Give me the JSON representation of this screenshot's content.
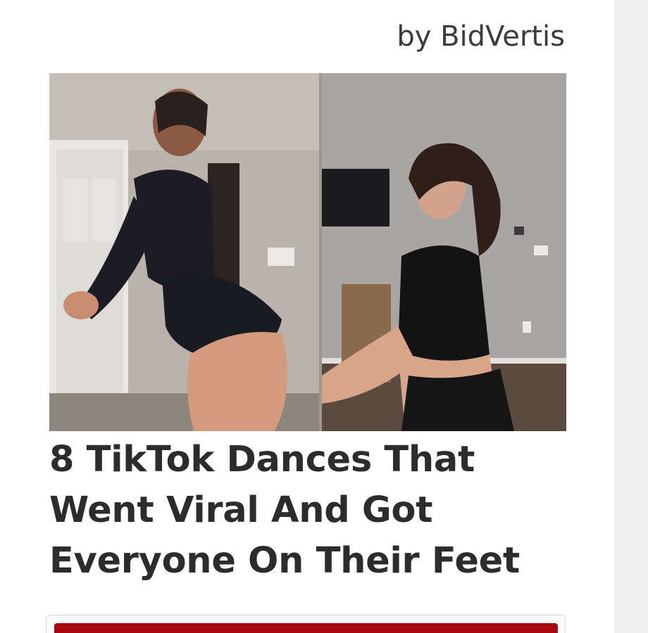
{
  "ad": {
    "sponsor_label": "by BidVertis",
    "image_alt": "Two women dancing in rooms",
    "headline": "8 TikTok Dances That Went Viral And Got Everyone On Their Feet"
  },
  "colors": {
    "headline": "#2c2c2c",
    "sponsor": "#3c3c3c",
    "cta_button": "#a8090c",
    "scrollbar_track": "#f0f0f0"
  }
}
